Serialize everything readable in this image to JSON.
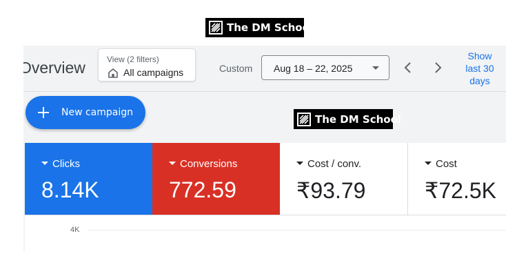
{
  "watermark": {
    "brand": "The DM School"
  },
  "header": {
    "page_title": "Overview",
    "view_filter": {
      "label": "View (2 filters)",
      "value": "All campaigns"
    },
    "date": {
      "label": "Custom",
      "range": "Aug 18 – 22, 2025"
    },
    "show_last_line1": "Show",
    "show_last_line2": "last 30",
    "show_last_line3": "days"
  },
  "actions": {
    "new_campaign": "New campaign"
  },
  "metrics": [
    {
      "label": "Clicks",
      "value": "8.14K",
      "color": "#1a73e8"
    },
    {
      "label": "Conversions",
      "value": "772.59",
      "color": "#d93025"
    },
    {
      "label": "Cost / conv.",
      "value": "₹93.79"
    },
    {
      "label": "Cost",
      "value": "₹72.5K"
    }
  ],
  "chart": {
    "y_tick": "4K"
  },
  "icons": {
    "view_filter": "home-icon",
    "date_dropdown": "caret-down-icon",
    "prev": "chevron-left-icon",
    "next": "chevron-right-icon",
    "add": "plus-icon"
  },
  "colors": {
    "accent": "#1a73e8",
    "conversions": "#d93025",
    "link": "#1a73e8"
  }
}
